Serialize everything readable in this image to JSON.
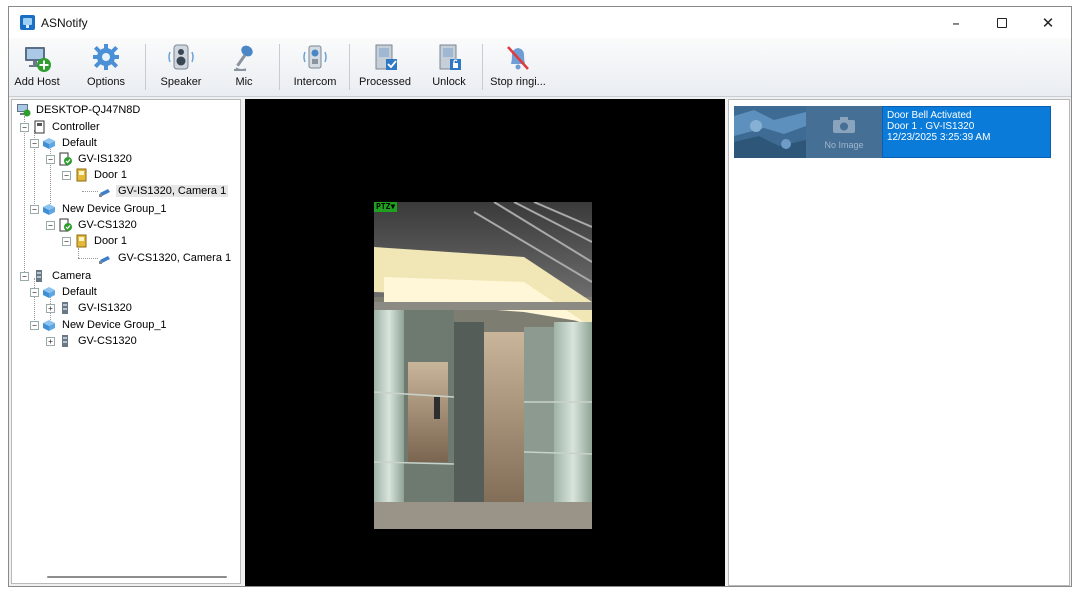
{
  "window": {
    "title": "ASNotify",
    "controls": {
      "minimize": "–",
      "close": "✕"
    }
  },
  "toolbar": {
    "buttons": [
      {
        "id": "add-host",
        "label": "Add Host",
        "icon": "add-host-icon"
      },
      {
        "id": "options",
        "label": "Options",
        "icon": "gear-icon"
      },
      {
        "id": "speaker",
        "label": "Speaker",
        "icon": "speaker-icon"
      },
      {
        "id": "mic",
        "label": "Mic",
        "icon": "microphone-icon"
      },
      {
        "id": "intercom",
        "label": "Intercom",
        "icon": "intercom-icon"
      },
      {
        "id": "processed",
        "label": "Processed",
        "icon": "processed-icon"
      },
      {
        "id": "unlock",
        "label": "Unlock",
        "icon": "unlock-door-icon"
      },
      {
        "id": "stop-ringing",
        "label": "Stop ringi...",
        "icon": "bell-off-icon"
      }
    ]
  },
  "tree": {
    "items": [
      {
        "label": "DESKTOP-QJ47N8D",
        "icon": "host-icon"
      },
      {
        "label": "Controller",
        "icon": "controller-icon"
      },
      {
        "label": "Default",
        "icon": "device-group-icon"
      },
      {
        "label": "GV-IS1320",
        "icon": "device-online-icon"
      },
      {
        "label": "Door 1",
        "icon": "door-icon"
      },
      {
        "label": "GV-IS1320, Camera 1",
        "icon": "camera-icon"
      },
      {
        "label": "New Device Group_1",
        "icon": "device-group-icon"
      },
      {
        "label": "GV-CS1320",
        "icon": "device-online-icon"
      },
      {
        "label": "Door 1",
        "icon": "door-icon"
      },
      {
        "label": "GV-CS1320, Camera 1",
        "icon": "camera-icon"
      },
      {
        "label": "Camera",
        "icon": "camera-folder-icon"
      },
      {
        "label": "Default",
        "icon": "device-group-icon"
      },
      {
        "label": "GV-IS1320",
        "icon": "camera-device-icon"
      },
      {
        "label": "New Device Group_1",
        "icon": "device-group-icon"
      },
      {
        "label": "GV-CS1320",
        "icon": "camera-device-icon"
      }
    ]
  },
  "video": {
    "overlay_badge": "PTZ▼"
  },
  "notifications": [
    {
      "title": "Door Bell Activated",
      "source": "Door 1 . GV-IS1320",
      "timestamp": "12/23/2025 3:25:39 AM",
      "placeholder_text": "No Image"
    }
  ],
  "colors": {
    "selection_blue": "#0a7bd9",
    "toolbar_gradient_top": "#fbfbfb",
    "toolbar_gradient_bottom": "#e9edf2",
    "video_background": "#000000",
    "ptz_badge": "#1fa11f"
  }
}
